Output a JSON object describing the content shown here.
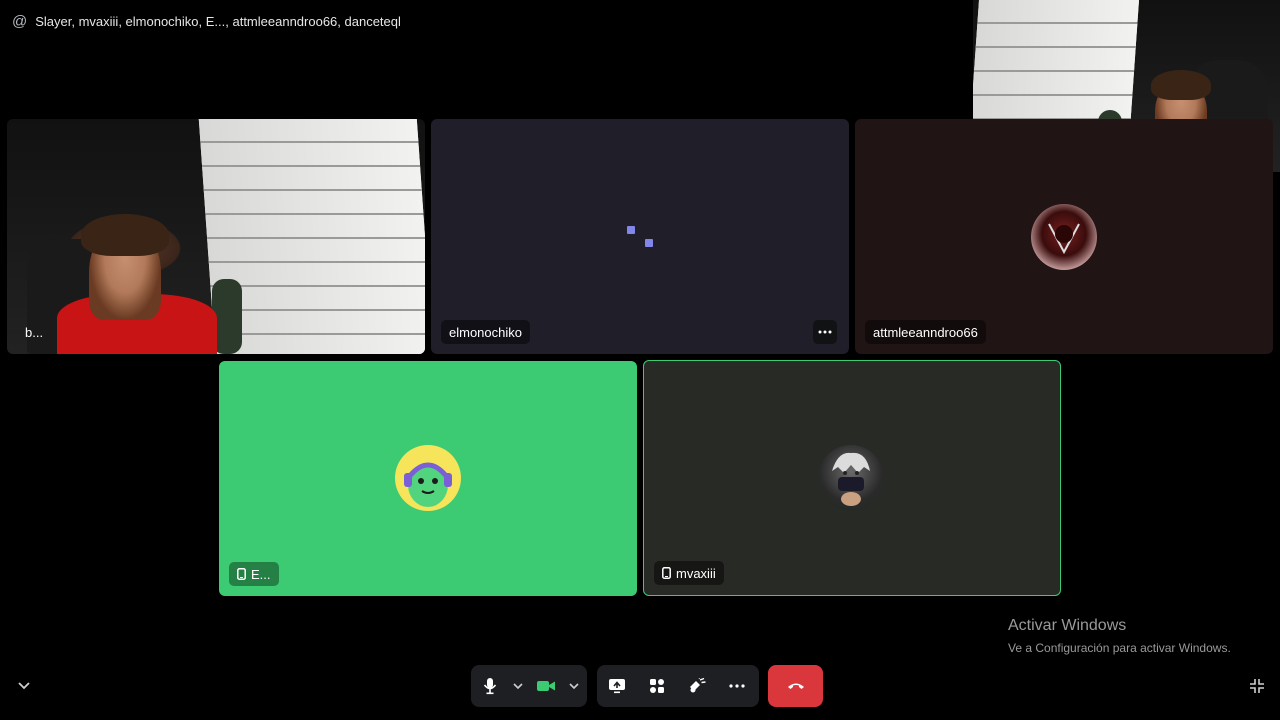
{
  "header": {
    "icon": "at-icon",
    "title": "Slayer, mvaxiii, elmonochiko, E..., attmleeanndroo66, danceteql"
  },
  "tiles": [
    {
      "label": "b...",
      "kind": "video"
    },
    {
      "label": "elmonochiko",
      "kind": "loading"
    },
    {
      "label": "attmleeanndroo66",
      "kind": "avatar"
    },
    {
      "label": "E...",
      "kind": "avatar",
      "device": "mobile-icon"
    },
    {
      "label": "mvaxiii",
      "kind": "avatar",
      "device": "mobile-icon"
    }
  ],
  "colors": {
    "loading_dots": "#8186e8",
    "speaking_tile": "#3ccb73",
    "speaking_border": "#3ccb73",
    "dark_tile": "#1f1e29",
    "maroon_tile": "#211414",
    "gray_tile": "#282a26",
    "end_call": "#da373c"
  },
  "watermark": {
    "line1": "Activar Windows",
    "line2": "Ve a Configuración para activar Windows."
  },
  "controls": {
    "mic": "microphone-icon",
    "camera": "video-camera-icon",
    "screenshare": "screen-share-icon",
    "activities": "activities-icon",
    "soundboard": "soundboard-icon",
    "more": "more-icon",
    "end": "end-call-icon"
  }
}
